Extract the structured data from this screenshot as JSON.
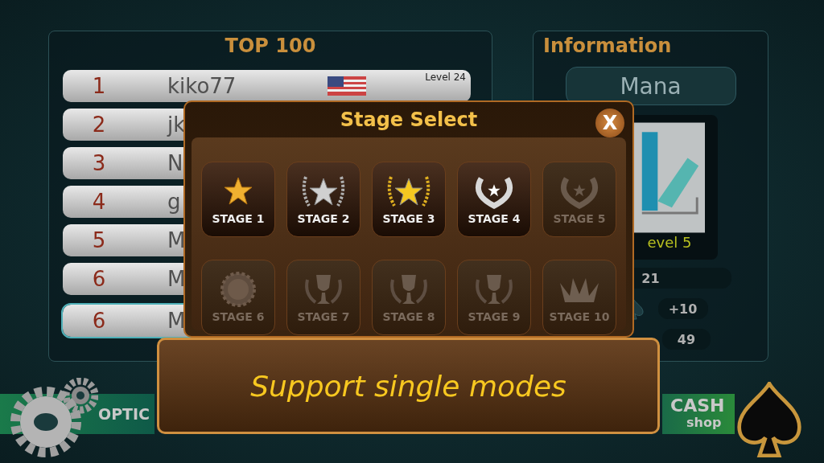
{
  "leaderboard": {
    "title": "TOP 100",
    "rows": [
      {
        "rank": "1",
        "name": "kiko77",
        "level": "Level 24",
        "selected": false,
        "flag": true
      },
      {
        "rank": "2",
        "name": "jk",
        "selected": false
      },
      {
        "rank": "3",
        "name": "N",
        "selected": false
      },
      {
        "rank": "4",
        "name": "g",
        "selected": false
      },
      {
        "rank": "5",
        "name": "M",
        "selected": false
      },
      {
        "rank": "6",
        "name": "M",
        "selected": false
      },
      {
        "rank": "6",
        "name": "M",
        "selected": true
      }
    ]
  },
  "information": {
    "title": "Information",
    "name": "Mana",
    "level": "evel 5",
    "count": "21",
    "bonus": "+10",
    "chips": "49"
  },
  "stage_select": {
    "title": "Stage Select",
    "close": "X",
    "stages": [
      {
        "label": "STAGE 1",
        "kind": "star",
        "locked": false
      },
      {
        "label": "STAGE 2",
        "kind": "silver-laurel",
        "locked": false
      },
      {
        "label": "STAGE 3",
        "kind": "gold-laurel",
        "locked": false
      },
      {
        "label": "STAGE 4",
        "kind": "wreath",
        "locked": false
      },
      {
        "label": "STAGE 5",
        "kind": "wreath",
        "locked": true
      },
      {
        "label": "STAGE 6",
        "kind": "medal",
        "locked": true
      },
      {
        "label": "STAGE 7",
        "kind": "trophy",
        "locked": true
      },
      {
        "label": "STAGE 8",
        "kind": "trophy",
        "locked": true
      },
      {
        "label": "STAGE 9",
        "kind": "trophy",
        "locked": true
      },
      {
        "label": "STAGE 10",
        "kind": "crown",
        "locked": true
      }
    ]
  },
  "banner": {
    "text": "Support single modes"
  },
  "bottom_bar": {
    "options": "OPTIC",
    "cash": "CASH",
    "shop": "shop"
  }
}
